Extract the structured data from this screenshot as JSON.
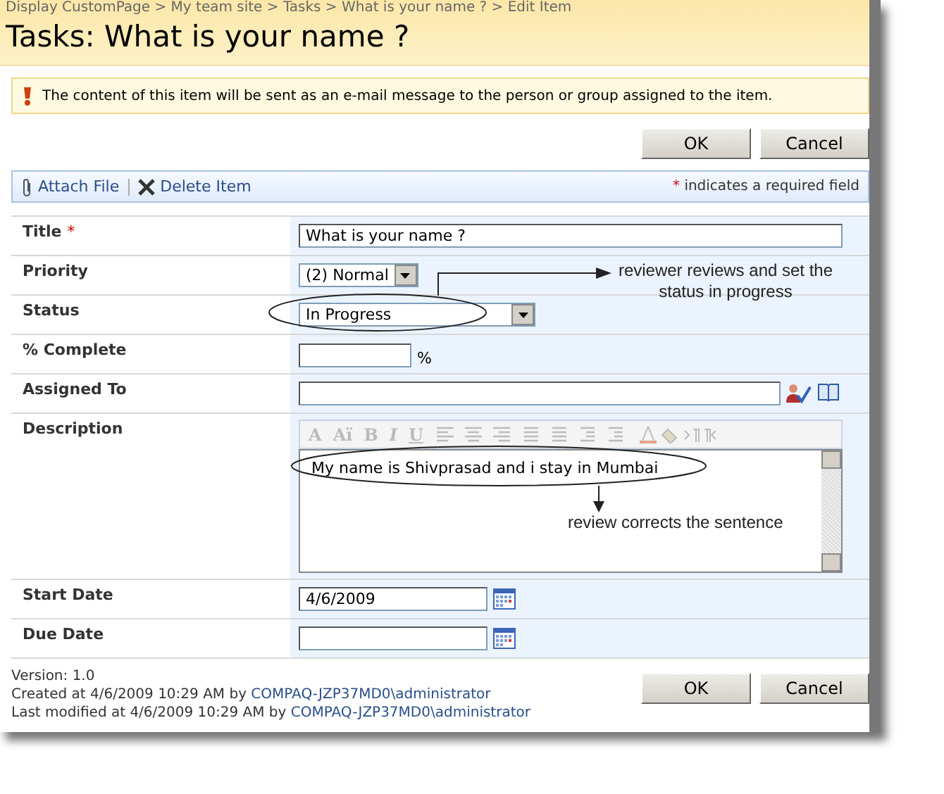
{
  "breadcrumb": "Display CustomPage > My team site > Tasks > What is your name ? > Edit Item",
  "title": "Tasks: What is your name ?",
  "notice": "The content of this item will be sent as an e-mail message to the person or group assigned to the item.",
  "buttons_top": [
    "OK",
    "Cancel"
  ],
  "toolbar": {
    "items": [
      {
        "kind": "attach",
        "label": "Attach File"
      },
      {
        "kind": "delete",
        "label": "Delete Item"
      }
    ],
    "required_mark": "*",
    "required_note": "indicates a required field"
  },
  "fields": [
    {
      "kind": "text",
      "label": "Title",
      "required_mark": "*",
      "value": "What is your name ?"
    },
    {
      "kind": "select",
      "label": "Priority",
      "value": "(2) Normal"
    },
    {
      "kind": "select",
      "label": "Status",
      "value": "In Progress"
    },
    {
      "kind": "number",
      "label": "% Complete",
      "suffix": "%"
    },
    {
      "kind": "people",
      "label": "Assigned To"
    },
    {
      "kind": "richtext",
      "label": "Description",
      "editor_buttons": [
        "A",
        "Aï",
        "B",
        "I",
        "U"
      ],
      "value": "My name is Shivprasad and i stay in Mumbai"
    },
    {
      "kind": "date",
      "label": "Start Date",
      "value": "4/6/2009"
    },
    {
      "kind": "date",
      "label": "Due Date"
    }
  ],
  "version": "Version: 1.0",
  "created": {
    "text": "Created at 4/6/2009 10:29 AM  by",
    "user": "COMPAQ-JZP37MD0\\administrator"
  },
  "modified": {
    "text": "Last modified at 4/6/2009 10:29 AM  by",
    "user": "COMPAQ-JZP37MD0\\administrator"
  },
  "buttons_bottom": [
    "OK",
    "Cancel"
  ],
  "annotations": [
    {
      "kind": "status-note",
      "text": "reviewer reviews and set the status in progress"
    },
    {
      "kind": "description-note",
      "text": "review corrects the sentence"
    }
  ]
}
